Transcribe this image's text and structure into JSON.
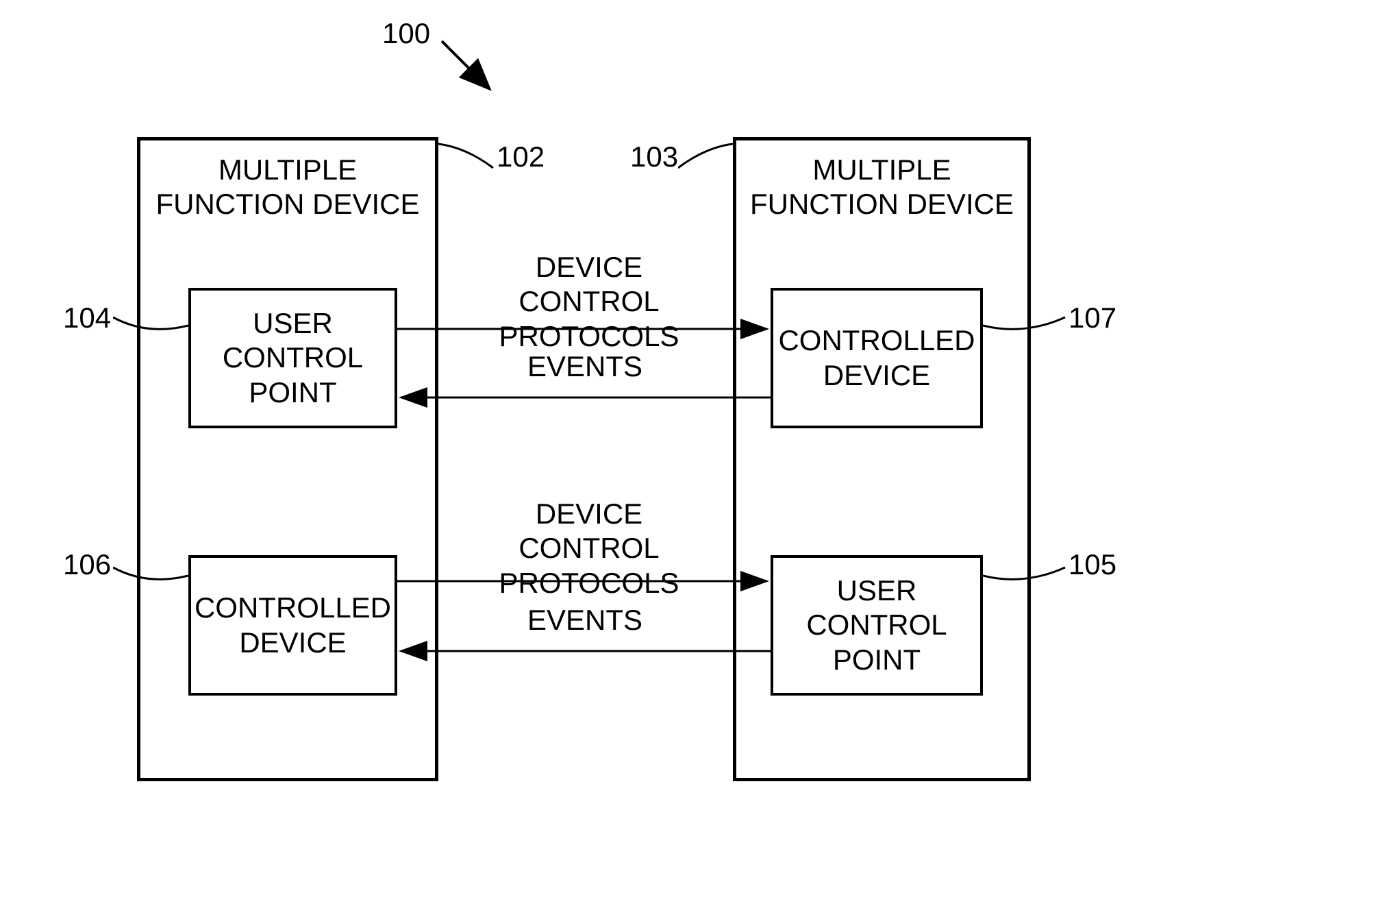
{
  "refs": {
    "n100": "100",
    "n102": "102",
    "n103": "103",
    "n104": "104",
    "n105": "105",
    "n106": "106",
    "n107": "107"
  },
  "left_device": {
    "title": "MULTIPLE FUNCTION DEVICE",
    "box_top": "USER CONTROL POINT",
    "box_bottom": "CONTROLLED DEVICE"
  },
  "right_device": {
    "title": "MULTIPLE FUNCTION DEVICE",
    "box_top": "CONTROLLED DEVICE",
    "box_bottom": "USER CONTROL POINT"
  },
  "arrows": {
    "top_forward": "DEVICE CONTROL PROTOCOLS",
    "top_back": "EVENTS",
    "bottom_forward": "DEVICE CONTROL PROTOCOLS",
    "bottom_back": "EVENTS"
  }
}
